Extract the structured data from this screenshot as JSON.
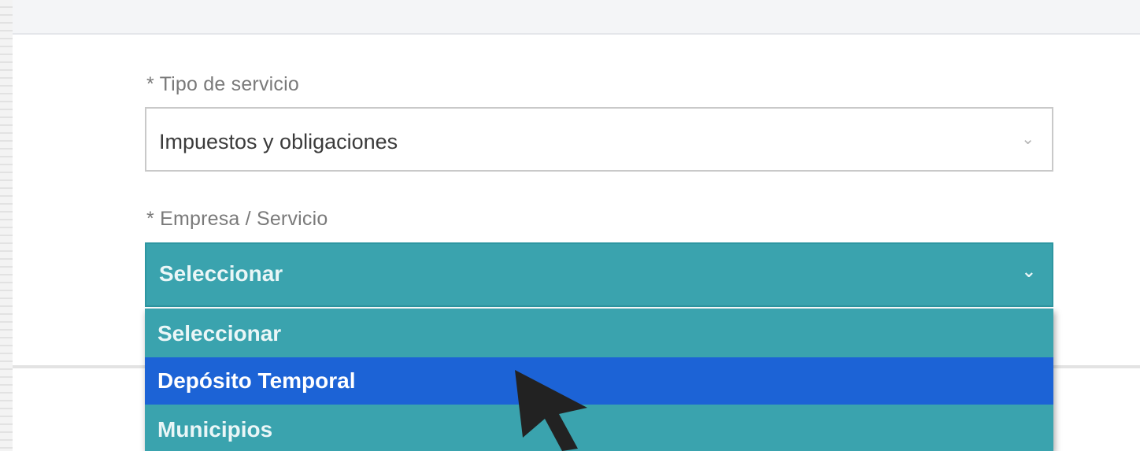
{
  "form": {
    "tipo_servicio": {
      "label": "* Tipo de servicio",
      "value": "Impuestos y obligaciones",
      "icon": "chevron-down-icon"
    },
    "empresa_servicio": {
      "label": "* Empresa / Servicio",
      "value": "Seleccionar",
      "icon": "chevron-down-icon",
      "options": [
        "Seleccionar",
        "Depósito Temporal",
        "Municipios"
      ],
      "highlighted_option": "Depósito Temporal"
    }
  },
  "colors": {
    "dropdown_bg": "#3aa3ae",
    "highlight_bg": "#1c63d6",
    "label_text": "#7a7a7a"
  },
  "cursor_icon": "arrow-cursor-icon"
}
